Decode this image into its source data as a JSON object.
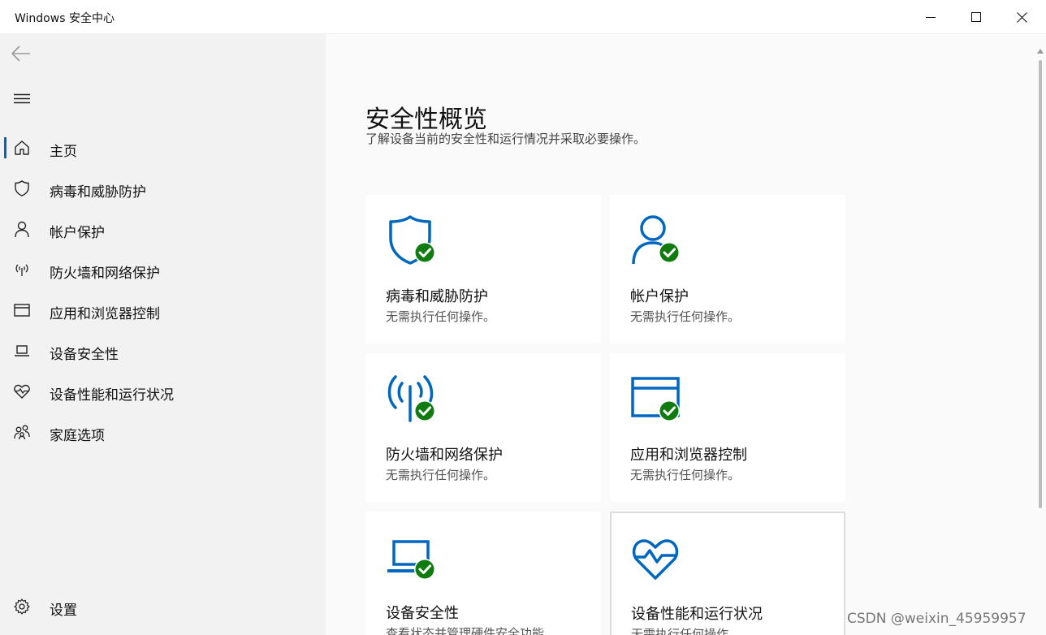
{
  "window": {
    "title": "Windows 安全中心"
  },
  "sidebar": {
    "items": [
      {
        "label": "主页",
        "icon": "home-icon"
      },
      {
        "label": "病毒和威胁防护",
        "icon": "shield-icon"
      },
      {
        "label": "帐户保护",
        "icon": "person-icon"
      },
      {
        "label": "防火墙和网络保护",
        "icon": "wireless-icon"
      },
      {
        "label": "应用和浏览器控制",
        "icon": "app-window-icon"
      },
      {
        "label": "设备安全性",
        "icon": "laptop-icon"
      },
      {
        "label": "设备性能和运行状况",
        "icon": "heart-icon"
      },
      {
        "label": "家庭选项",
        "icon": "family-icon"
      }
    ],
    "settings_label": "设置"
  },
  "main": {
    "title": "安全性概览",
    "subtitle": "了解设备当前的安全性和运行情况并采取必要操作。",
    "cards": [
      {
        "title": "病毒和威胁防护",
        "status": "无需执行任何操作。",
        "icon": "shield-check-icon"
      },
      {
        "title": "帐户保护",
        "status": "无需执行任何操作。",
        "icon": "person-check-icon"
      },
      {
        "title": "防火墙和网络保护",
        "status": "无需执行任何操作。",
        "icon": "wireless-check-icon"
      },
      {
        "title": "应用和浏览器控制",
        "status": "无需执行任何操作。",
        "icon": "browser-check-icon"
      },
      {
        "title": "设备安全性",
        "status": "查看状态并管理硬件安全功能",
        "icon": "laptop-check-icon"
      },
      {
        "title": "设备性能和运行状况",
        "status": "无需执行任何操作。",
        "icon": "heart-pulse-icon"
      }
    ]
  },
  "watermark": "CSDN @weixin_45959957",
  "colors": {
    "accent": "#0067c0",
    "check": "#107c10",
    "sidebar_bg": "#f2f2f2",
    "main_bg": "#fafafa"
  }
}
